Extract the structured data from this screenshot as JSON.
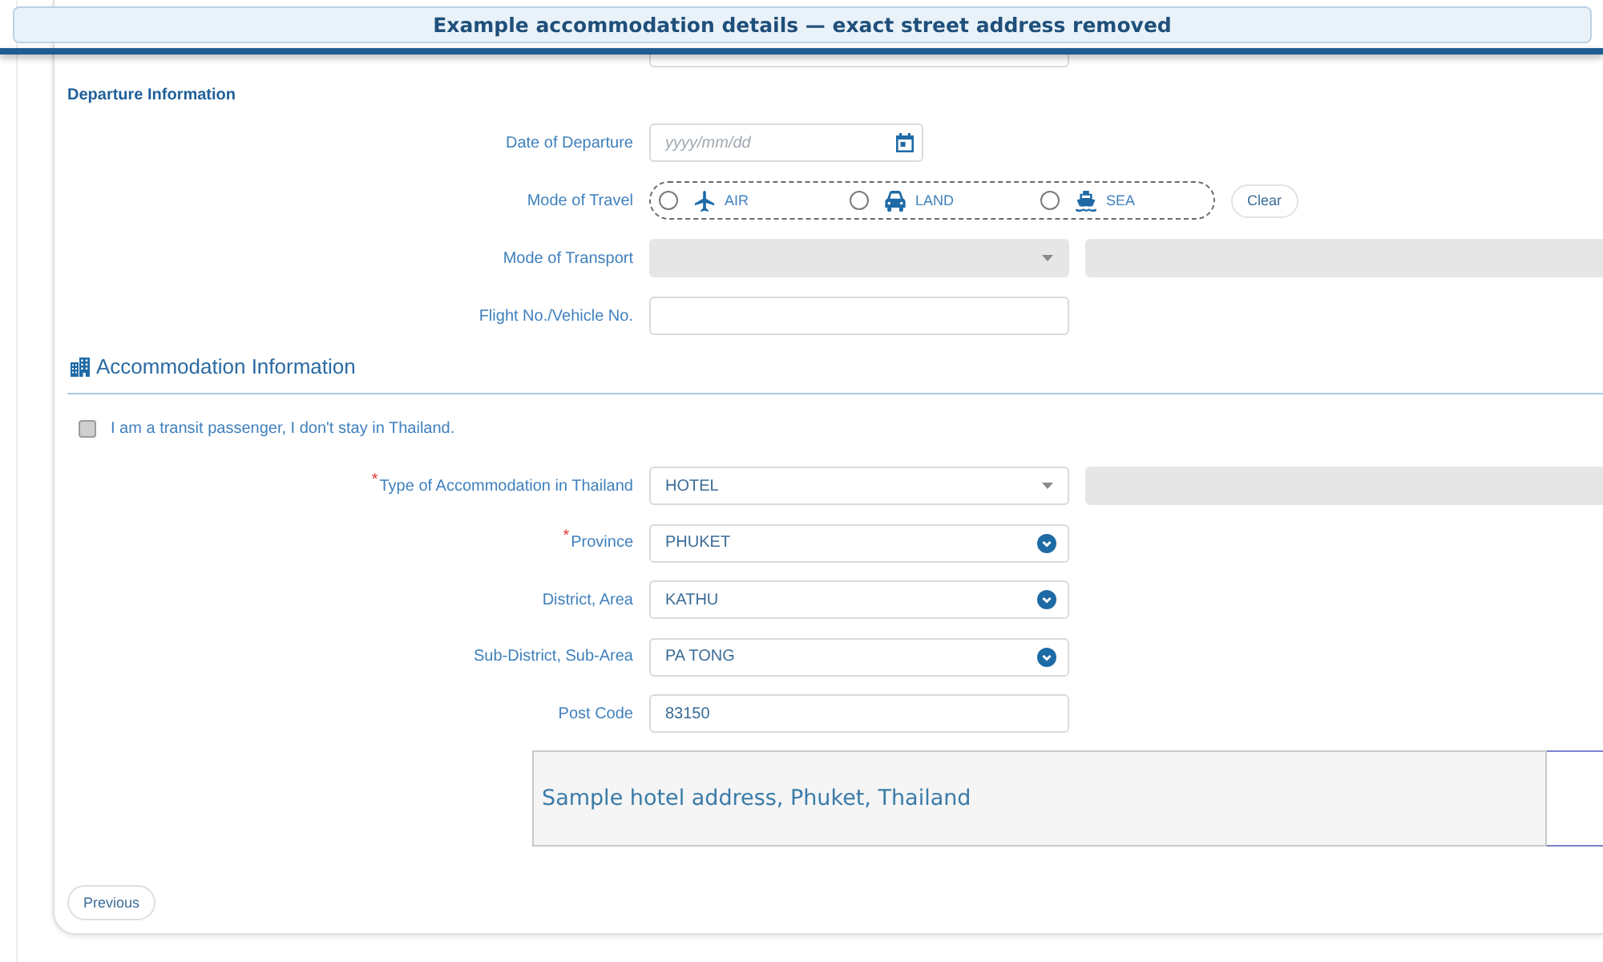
{
  "banner": {
    "title": "Example accommodation details — exact street address removed"
  },
  "departure": {
    "heading": "Departure Information",
    "date": {
      "label": "Date of Departure",
      "placeholder": "yyyy/mm/dd"
    },
    "travel": {
      "label": "Mode of Travel",
      "options": [
        {
          "label": "AIR",
          "kind": "air",
          "selected": false
        },
        {
          "label": "LAND",
          "kind": "land",
          "selected": false
        },
        {
          "label": "SEA",
          "kind": "sea",
          "selected": false
        }
      ],
      "clear": "Clear"
    },
    "transport": {
      "label": "Mode of Transport",
      "disabled": true,
      "other_field": {
        "disabled": true
      }
    },
    "vehicle": {
      "label": "Flight No./Vehicle No."
    }
  },
  "accommodation": {
    "heading": "Accommodation Information",
    "transit": {
      "label": "I am a transit passenger, I don't stay in Thailand.",
      "checked": false
    },
    "fields": [
      {
        "label": "Type of Accommodation in Thailand",
        "required_mark": "*",
        "kind": "select",
        "value": "HOTEL",
        "other_field": {
          "disabled": true
        }
      },
      {
        "label": "Province",
        "required_mark": "*",
        "kind": "combo",
        "value": "PHUKET"
      },
      {
        "label": "District, Area",
        "kind": "combo",
        "value": "KATHU"
      },
      {
        "label": "Sub-District, Sub-Area",
        "kind": "combo",
        "value": "PA TONG"
      },
      {
        "label": "Post Code",
        "kind": "text",
        "value": "83150"
      }
    ],
    "address_note": "Sample hotel address, Phuket, Thailand"
  },
  "buttons": [
    {
      "label": "Previous"
    }
  ]
}
